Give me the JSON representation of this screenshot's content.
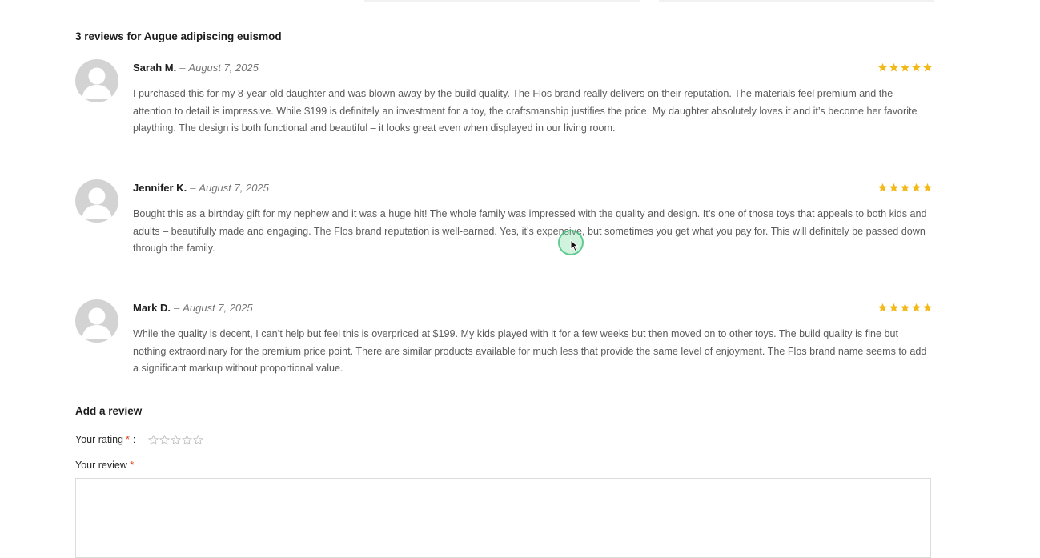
{
  "reviews_title": "3 reviews for Augue adipiscing euismod",
  "colors": {
    "star_filled": "#f2b91b",
    "star_empty": "#bfbfbf",
    "required": "#e2401c",
    "avatar": "#d3d3d3",
    "cursor_highlight": "#3cbe78"
  },
  "reviews": [
    {
      "author": "Sarah M.",
      "separator": "–",
      "date": "August 7, 2025",
      "rating": 5,
      "text": "I purchased this for my 8-year-old daughter and was blown away by the build quality. The Flos brand really delivers on their reputation. The materials feel premium and the attention to detail is impressive. While $199 is definitely an investment for a toy, the craftsmanship justifies the price. My daughter absolutely loves it and it’s become her favorite plaything. The design is both functional and beautiful – it looks great even when displayed in our living room."
    },
    {
      "author": "Jennifer K.",
      "separator": "–",
      "date": "August 7, 2025",
      "rating": 5,
      "text": "Bought this as a birthday gift for my nephew and it was a huge hit! The whole family was impressed with the quality and design. It’s one of those toys that appeals to both kids and adults – beautifully made and engaging. The Flos brand reputation is well-earned. Yes, it’s expensive, but sometimes you get what you pay for. This will definitely be passed down through the family."
    },
    {
      "author": "Mark D.",
      "separator": "–",
      "date": "August 7, 2025",
      "rating": 5,
      "text": "While the quality is decent, I can’t help but feel this is overpriced at $199. My kids played with it for a few weeks but then moved on to other toys. The build quality is fine but nothing extraordinary for the premium price point. There are similar products available for much less that provide the same level of enjoyment. The Flos brand name seems to add a significant markup without proportional value."
    }
  ],
  "add_review": {
    "title": "Add a review",
    "rating_label": "Your rating",
    "required_mark": "*",
    "rating_colon": ":",
    "rating_max": 5,
    "review_label": "Your review",
    "review_value": ""
  }
}
